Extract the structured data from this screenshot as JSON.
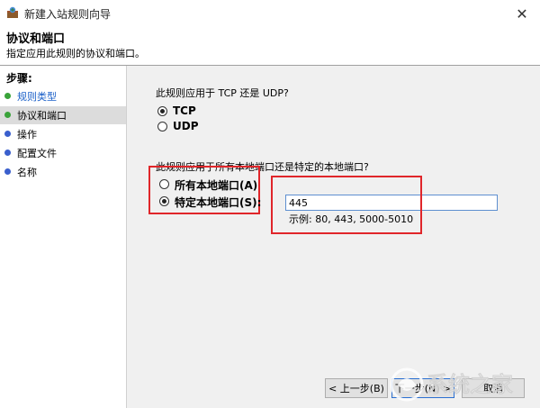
{
  "window": {
    "title": "新建入站规则向导"
  },
  "header": {
    "title": "协议和端口",
    "subtitle": "指定应用此规则的协议和端口。"
  },
  "steps": {
    "title": "步骤:",
    "items": [
      {
        "label": "规则类型",
        "color": "#3aa33a",
        "active": false,
        "link": true
      },
      {
        "label": "协议和端口",
        "color": "#3aa33a",
        "active": true,
        "link": false
      },
      {
        "label": "操作",
        "color": "#3a5fcd",
        "active": false,
        "link": false
      },
      {
        "label": "配置文件",
        "color": "#3a5fcd",
        "active": false,
        "link": false
      },
      {
        "label": "名称",
        "color": "#3a5fcd",
        "active": false,
        "link": false
      }
    ]
  },
  "protocol": {
    "question": "此规则应用于 TCP 还是 UDP?",
    "options": [
      {
        "label": "TCP",
        "checked": true
      },
      {
        "label": "UDP",
        "checked": false
      }
    ]
  },
  "ports": {
    "question": "此规则应用于所有本地端口还是特定的本地端口?",
    "options": [
      {
        "label": "所有本地端口(A)",
        "checked": false
      },
      {
        "label": "特定本地端口(S):",
        "checked": true
      }
    ],
    "value": "445",
    "example": "示例: 80, 443, 5000-5010"
  },
  "buttons": {
    "back": "< 上一步(B)",
    "next": "下一步(N) >",
    "cancel": "取消"
  },
  "watermark": {
    "text": "系统之家"
  },
  "colors": {
    "highlight": "#e0262a",
    "accent": "#2a6fd1"
  }
}
